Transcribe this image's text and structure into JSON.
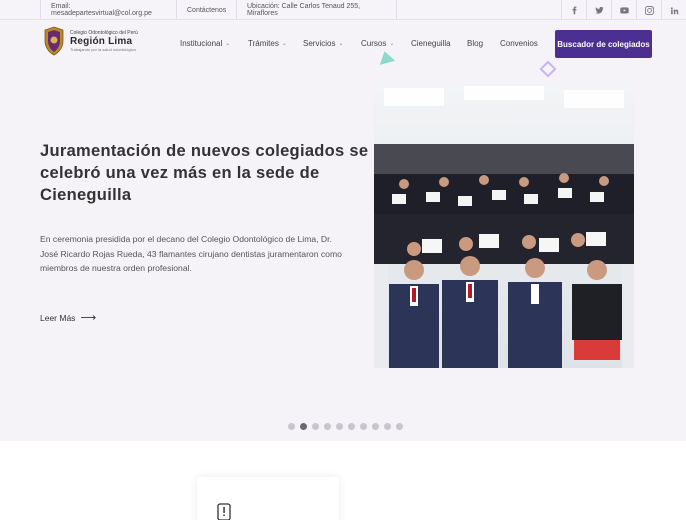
{
  "topbar": {
    "email": "Email: mesadepartesvirtual@col.org.pe",
    "contact": "Contáctenos",
    "location": "Ubicación: Calle Carlos Tenaud 255, Miraflores",
    "social": [
      "facebook-icon",
      "twitter-icon",
      "youtube-icon",
      "instagram-icon",
      "linkedin-icon"
    ]
  },
  "logo": {
    "top": "Colegio Odontológico del Perú",
    "main": "Región Lima",
    "sub": "Trabajando por la salud odontológica"
  },
  "nav": {
    "institucional": "Institucional",
    "tramites": "Trámites",
    "servicios": "Servicios",
    "cursos": "Cursos",
    "cieneguilla": "Cieneguilla",
    "blog": "Blog",
    "convenios": "Convenios",
    "search_button": "Buscador de colegiados"
  },
  "hero": {
    "title": "Juramentación de nuevos colegiados se celebró una vez más en la sede de Cieneguilla",
    "description": "En ceremonia presidida por el decano del Colegio Odontológico de Lima, Dr. José Ricardo Rojas Rueda, 43 flamantes cirujano dentistas juramentaron como miembros de nuestra orden profesional.",
    "read_more": "Leer Más",
    "arrow": "⟶"
  },
  "carousel": {
    "dot_count": 10,
    "active_index": 1
  },
  "colors": {
    "accent": "#4b2f91",
    "background": "#f6f3f8"
  }
}
